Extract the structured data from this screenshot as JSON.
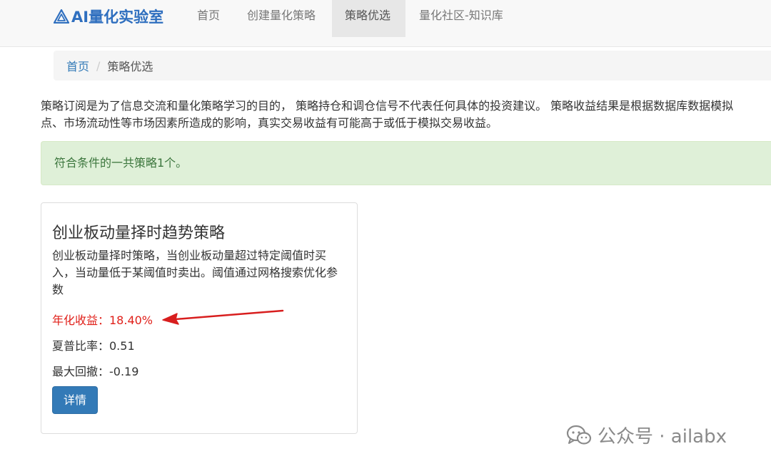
{
  "brand": {
    "name": "AI量化实验室",
    "color": "#2f6fbf"
  },
  "nav": {
    "items": [
      {
        "label": "首页"
      },
      {
        "label": "创建量化策略"
      },
      {
        "label": "策略优选",
        "active": true
      },
      {
        "label": "量化社区-知识库"
      }
    ]
  },
  "breadcrumb": {
    "home": "首页",
    "separator": "/",
    "current": "策略优选"
  },
  "disclaimer": {
    "line1": "策略订阅是为了信息交流和量化策略学习的目的， 策略持仓和调仓信号不代表任何具体的投资建议。 策略收益结果是根据数据库数据模拟",
    "line2": "点、市场流动性等市场因素所造成的影响，真实交易收益有可能高于或低于模拟交易收益。"
  },
  "alert": {
    "text": "符合条件的一共策略1个。"
  },
  "strategy_card": {
    "title": "创业板动量择时趋势策略",
    "description": "创业板动量择时策略，当创业板动量超过特定阈值时买入，当动量低于某阈值时卖出。阈值通过网格搜索优化参数",
    "annual_return": "年化收益：18.40%",
    "sharpe_ratio": "夏普比率：0.51",
    "max_drawdown": "最大回撤：-0.19",
    "detail_button": "详情",
    "highlight_color": "#e0201a",
    "button_color": "#337ab7"
  },
  "watermark": {
    "icon": "wechat-icon",
    "text": "公众号 · ailabx"
  }
}
